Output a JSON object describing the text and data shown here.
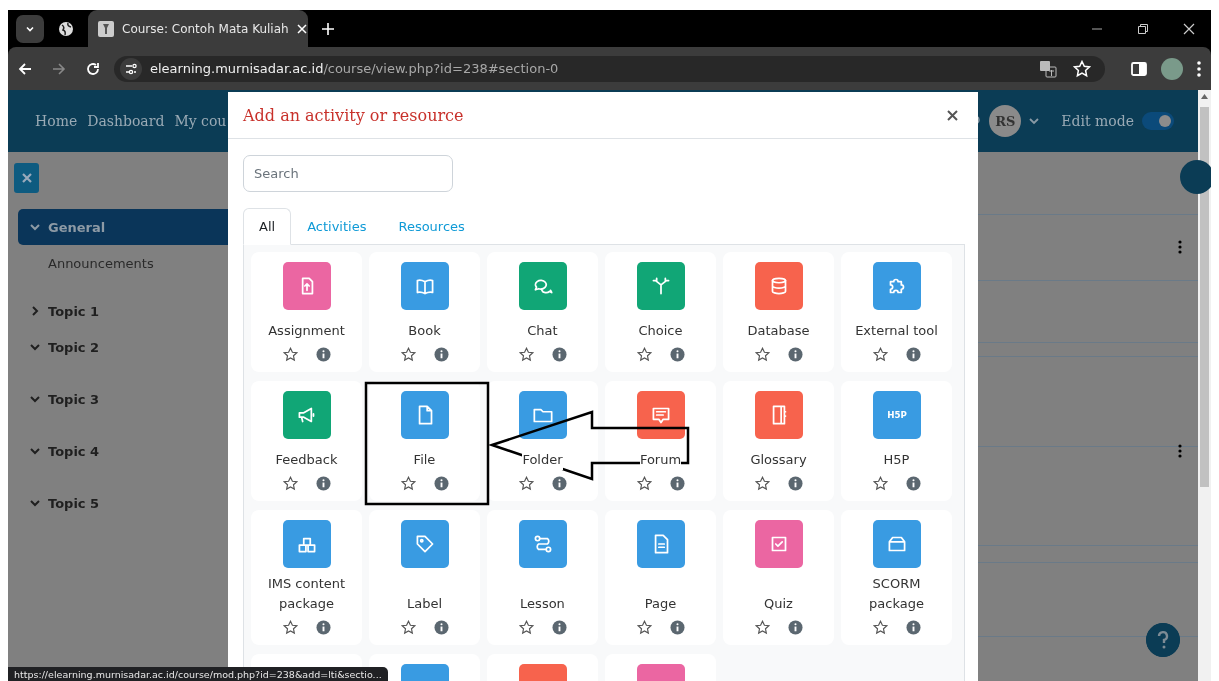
{
  "browser": {
    "tab": {
      "title": "Course: Contoh Mata Kuliah",
      "selected": true
    },
    "address": {
      "host": "elearning.murnisadar.ac.id",
      "path": "/course/view.php?id=238#section-0"
    },
    "status_url": "https://elearning.murnisadar.ac.id/course/mod.php?id=238&add=lti&sectio..."
  },
  "navbar": {
    "links": [
      "Home",
      "Dashboard",
      "My cou"
    ],
    "avatar": "RS",
    "edit_mode": {
      "label": "Edit mode",
      "on": true
    }
  },
  "course_index": [
    {
      "label": "General",
      "selected": true,
      "expanded": true,
      "children": [
        {
          "label": "Announcements",
          "selected": false
        }
      ]
    },
    {
      "label": "Topic 1",
      "selected": false,
      "expanded": false
    },
    {
      "label": "Topic 2",
      "selected": false,
      "expanded": true
    },
    {
      "label": "Topic 3",
      "selected": false,
      "expanded": true
    },
    {
      "label": "Topic 4",
      "selected": false,
      "expanded": true
    },
    {
      "label": "Topic 5",
      "selected": false,
      "expanded": true
    }
  ],
  "modal": {
    "title": "Add an activity or resource",
    "search": {
      "placeholder": "Search"
    },
    "tabs": [
      {
        "label": "All",
        "selected": true
      },
      {
        "label": "Activities",
        "selected": false
      },
      {
        "label": "Resources",
        "selected": false
      }
    ],
    "tiles": [
      {
        "name": "Assignment",
        "color": "#eb66a2"
      },
      {
        "name": "Book",
        "color": "#399be2"
      },
      {
        "name": "Chat",
        "color": "#11a676"
      },
      {
        "name": "Choice",
        "color": "#11a676"
      },
      {
        "name": "Database",
        "color": "#f7634d"
      },
      {
        "name": "External tool",
        "color": "#399be2"
      },
      {
        "name": "Feedback",
        "color": "#11a676"
      },
      {
        "name": "File",
        "color": "#399be2"
      },
      {
        "name": "Folder",
        "color": "#399be2"
      },
      {
        "name": "Forum",
        "color": "#f7634d"
      },
      {
        "name": "Glossary",
        "color": "#f7634d"
      },
      {
        "name": "H5P",
        "color": "#399be2",
        "logo": "H5P"
      },
      {
        "name": "IMS content package",
        "color": "#399be2"
      },
      {
        "name": "Label",
        "color": "#399be2"
      },
      {
        "name": "Lesson",
        "color": "#399be2"
      },
      {
        "name": "Page",
        "color": "#399be2"
      },
      {
        "name": "Quiz",
        "color": "#eb66a2"
      },
      {
        "name": "SCORM package",
        "color": "#399be2"
      }
    ],
    "partial_tiles": [
      {
        "kind": "covered"
      },
      {
        "kind": "icon",
        "color": "#399be2"
      },
      {
        "kind": "icon",
        "color": "#f7634d"
      },
      {
        "kind": "icon",
        "color": "#eb66a2"
      }
    ]
  }
}
